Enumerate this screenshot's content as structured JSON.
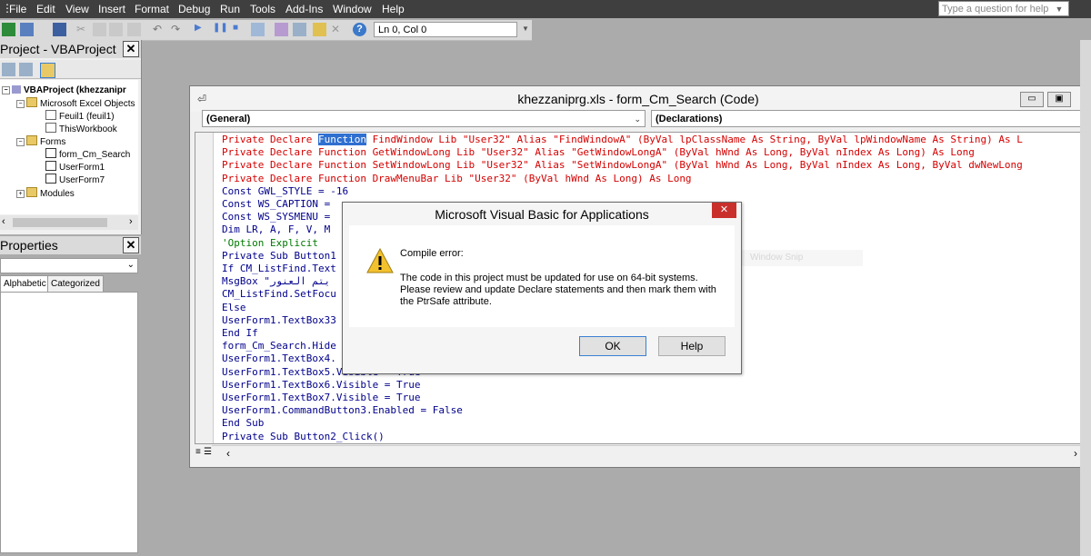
{
  "menu": {
    "items": [
      "File",
      "Edit",
      "View",
      "Insert",
      "Format",
      "Debug",
      "Run",
      "Tools",
      "Add-Ins",
      "Window",
      "Help"
    ],
    "help_placeholder": "Type a question for help"
  },
  "toolbar": {
    "position": "Ln 0, Col 0"
  },
  "project": {
    "title": "Project - VBAProject",
    "close": "✕",
    "tree": {
      "root": "VBAProject (khezzanipr",
      "excel_objects": "Microsoft Excel Objects",
      "sheet1": "Feuil1 (feuil1)",
      "workbook": "ThisWorkbook",
      "forms": "Forms",
      "form1": "form_Cm_Search",
      "form2": "UserForm1",
      "form3": "UserForm7",
      "modules": "Modules"
    }
  },
  "properties": {
    "title": "Properties",
    "close": "✕",
    "tab_alphabetic": "Alphabetic",
    "tab_categorized": "Categorized"
  },
  "code_window": {
    "title": "khezzaniprg.xls - form_Cm_Search (Code)",
    "object_combo": "(General)",
    "proc_combo": "(Declarations)",
    "lines": [
      {
        "pre": "Private Declare ",
        "sel": "Function",
        "post": " FindWindow Lib \"User32\" Alias \"FindWindowA\" (ByVal lpClassName As String, ByVal lpWindowName As String) As L",
        "cls": "red"
      },
      {
        "pre": "Private Declare Function GetWindowLong Lib \"User32\" Alias \"GetWindowLongA\" (ByVal hWnd As Long, ByVal nIndex As Long) As Long",
        "cls": "red"
      },
      {
        "pre": "Private Declare Function SetWindowLong Lib \"User32\" Alias \"SetWindowLongA\" (ByVal hWnd As Long, ByVal nIndex As Long, ByVal dwNewLong",
        "cls": "red"
      },
      {
        "pre": "Private Declare Function DrawMenuBar Lib \"User32\" (ByVal hWnd As Long) As Long",
        "cls": "red"
      },
      {
        "pre": "Const GWL_STYLE = -16",
        "cls": "kw"
      },
      {
        "pre": "Const WS_CAPTION =",
        "cls": "kw"
      },
      {
        "pre": "Const WS_SYSMENU =",
        "cls": "kw"
      },
      {
        "pre": "Dim LR, A, F, V, M",
        "cls": "kw"
      },
      {
        "pre": "'Option Explicit",
        "cls": "grn"
      },
      {
        "pre": "Private Sub Button1",
        "cls": "kw"
      },
      {
        "pre": "If CM_ListFind.Text",
        "cls": "kw"
      },
      {
        "pre": "MsgBox \"يتم العنور",
        "cls": "kw"
      },
      {
        "pre": "CM_ListFind.SetFocu",
        "cls": "kw"
      },
      {
        "pre": "Else",
        "cls": "kw"
      },
      {
        "pre": "UserForm1.TextBox33",
        "cls": "kw"
      },
      {
        "pre": "End If",
        "cls": "kw"
      },
      {
        "pre": "form_Cm_Search.Hide",
        "cls": "kw"
      },
      {
        "pre": "UserForm1.TextBox4.",
        "cls": "kw"
      },
      {
        "pre": "UserForm1.TextBox5.Visible = True",
        "cls": "kw"
      },
      {
        "pre": "UserForm1.TextBox6.Visible = True",
        "cls": "kw"
      },
      {
        "pre": "UserForm1.TextBox7.Visible = True",
        "cls": "kw"
      },
      {
        "pre": "UserForm1.CommandButton3.Enabled = False",
        "cls": "kw"
      },
      {
        "pre": "End Sub",
        "cls": "kw"
      },
      {
        "pre": "Private Sub Button2_Click()",
        "cls": "kw"
      }
    ]
  },
  "snip_ghost": "Window Snip",
  "dialog": {
    "title": "Microsoft Visual Basic for Applications",
    "close": "✕",
    "heading": "Compile error:",
    "message_lines": [
      "The code in this project must be updated for use on 64-bit systems.",
      "Please review and update Declare statements and then mark them with",
      "the PtrSafe attribute."
    ],
    "ok_label": "OK",
    "help_label": "Help"
  },
  "colors": {
    "menubar_bg": "#3f3f3f",
    "code_red": "#d40000",
    "code_keyword": "#00008b",
    "code_comment": "#007a00",
    "selection": "#2f6fd0",
    "dialog_close": "#c9302c"
  }
}
